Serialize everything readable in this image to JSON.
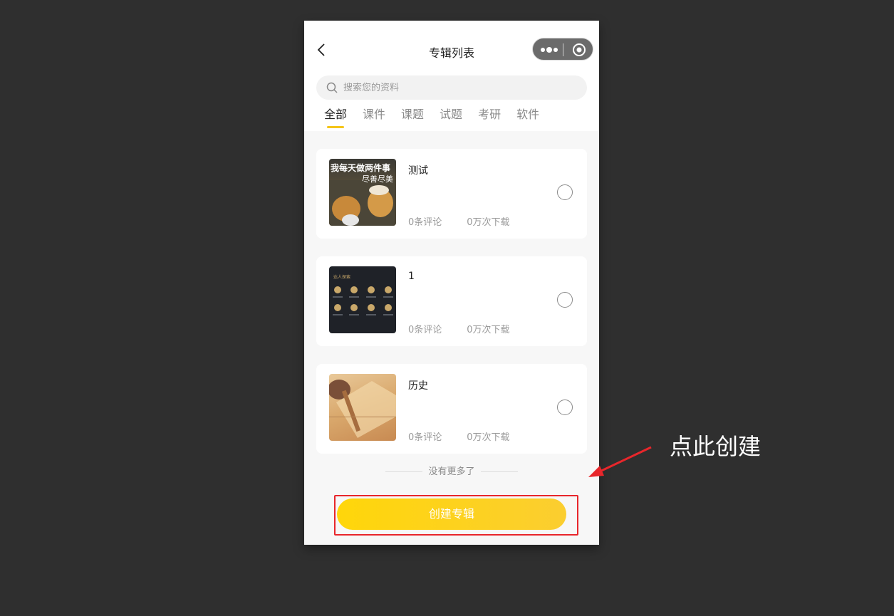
{
  "nav": {
    "title": "专辑列表",
    "back_icon": "chevron-left-icon",
    "capsule": {
      "more_icon": "more-dots-icon",
      "close_icon": "target-close-icon"
    }
  },
  "search": {
    "placeholder": "搜索您的资料",
    "value": ""
  },
  "tabs": [
    {
      "label": "全部",
      "active": true
    },
    {
      "label": "课件",
      "active": false
    },
    {
      "label": "课题",
      "active": false
    },
    {
      "label": "试题",
      "active": false
    },
    {
      "label": "考研",
      "active": false
    },
    {
      "label": "软件",
      "active": false
    }
  ],
  "albums": [
    {
      "title": "测试",
      "comments": "0条评论",
      "downloads": "0万次下载",
      "selected": false,
      "thumb_caption_line1": "我每天做两件事",
      "thumb_caption_line2": "尽善尽美"
    },
    {
      "title": "1",
      "comments": "0条评论",
      "downloads": "0万次下载",
      "selected": false,
      "thumb_caption_line1": "达人探索"
    },
    {
      "title": "历史",
      "comments": "0条评论",
      "downloads": "0万次下载",
      "selected": false
    }
  ],
  "end_note": "没有更多了",
  "create_button": "创建专辑",
  "annotation": {
    "callout": "点此创建",
    "highlight_color": "#e8262b"
  },
  "colors": {
    "accent": "#f5c518",
    "button_start": "#ffd60a",
    "button_end": "#fbce30",
    "backdrop": "#2f2f2f"
  }
}
